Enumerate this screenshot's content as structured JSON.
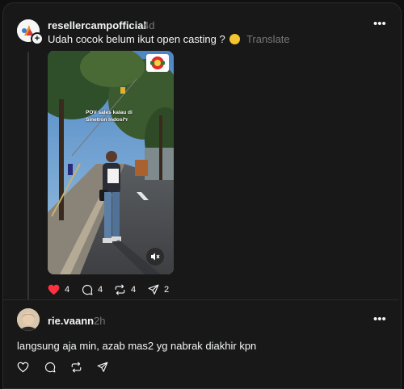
{
  "post": {
    "username": "resellercampofficial",
    "time": "4d",
    "text": "Udah cocok belum ikut open casting ?",
    "translate_label": "Translate",
    "video": {
      "caption_line1": "POV sales kalau di",
      "caption_line2": "Sinetron Indosi*r"
    },
    "actions": {
      "likes": "4",
      "comments": "4",
      "reposts": "4",
      "shares": "2"
    },
    "liked": true
  },
  "reply": {
    "username": "rie.vaann",
    "time": "2h",
    "text": "langsung aja min, azab mas2 yg nabrak diakhir kpn"
  },
  "colors": {
    "background": "#101010",
    "card": "#181818",
    "text_primary": "#f3f5f7",
    "text_secondary": "#777777",
    "like_red": "#ff3040"
  }
}
